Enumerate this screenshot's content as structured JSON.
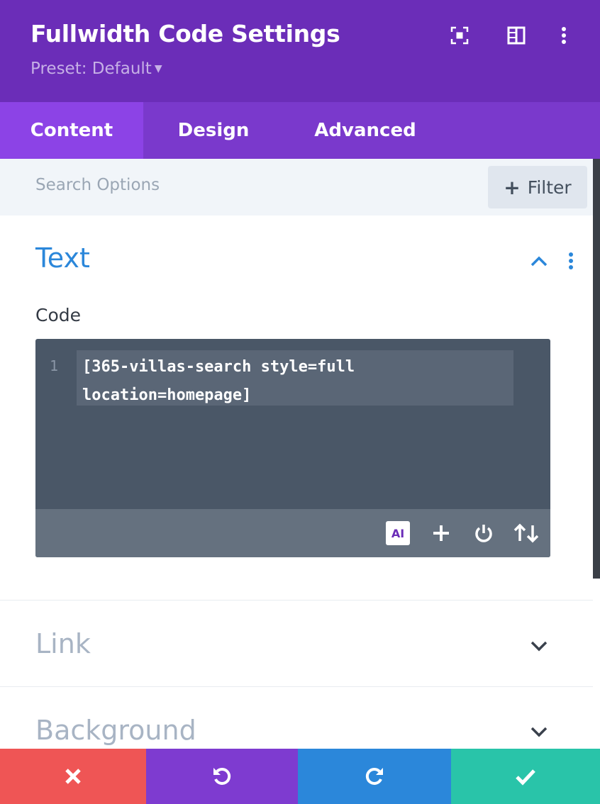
{
  "header": {
    "title": "Fullwidth Code Settings",
    "preset_label": "Preset: Default",
    "icons": [
      "fullscreen-icon",
      "split-view-icon",
      "more-options-icon"
    ]
  },
  "tabs": [
    {
      "label": "Content",
      "active": true
    },
    {
      "label": "Design",
      "active": false
    },
    {
      "label": "Advanced",
      "active": false
    }
  ],
  "search": {
    "placeholder": "Search Options",
    "value": "",
    "filter_label": "Filter"
  },
  "sections": {
    "text": {
      "title": "Text",
      "expanded": true,
      "code_label": "Code",
      "editor": {
        "line_number": "1",
        "code": "[365-villas-search style=full\nlocation=homepage]",
        "ai_label": "AI",
        "tools": [
          "ai-icon",
          "add-icon",
          "power-icon",
          "sort-icon"
        ]
      }
    },
    "link": {
      "title": "Link",
      "expanded": false
    },
    "background": {
      "title": "Background",
      "expanded": false
    }
  },
  "footer": {
    "buttons": [
      {
        "name": "discard",
        "color": "#ef5555",
        "icon": "close-icon"
      },
      {
        "name": "undo",
        "color": "#7e3bd0",
        "icon": "undo-icon"
      },
      {
        "name": "redo",
        "color": "#2b87da",
        "icon": "redo-icon"
      },
      {
        "name": "save",
        "color": "#29c4a9",
        "icon": "check-icon"
      }
    ]
  },
  "colors": {
    "header_bg": "#6b2db8",
    "tabs_bg": "#7a39cc",
    "active_tab_bg": "#8c43e6",
    "accent_blue": "#2b87da",
    "editor_bg": "#4a5767"
  }
}
